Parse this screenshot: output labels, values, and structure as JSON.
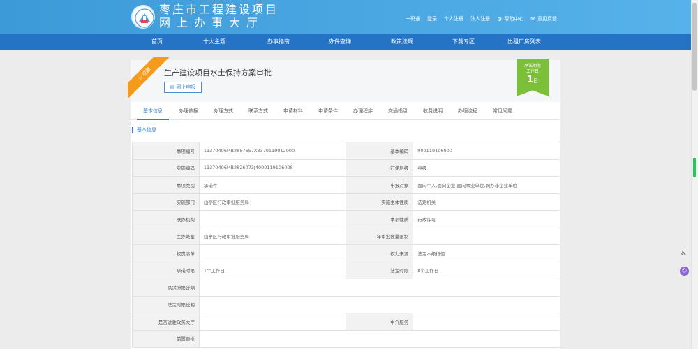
{
  "header": {
    "site_name_line1": "枣庄市工程建设项目",
    "site_name_line2": "网上办事大厅",
    "links": [
      {
        "label": "一码通",
        "icon": ""
      },
      {
        "label": "登录",
        "icon": ""
      },
      {
        "label": "个人注册",
        "icon": ""
      },
      {
        "label": "法人注册",
        "icon": ""
      },
      {
        "label": "帮助中心",
        "icon": "gear-icon"
      },
      {
        "label": "意见反馈",
        "icon": "message-icon"
      }
    ]
  },
  "nav": {
    "items": [
      {
        "label": "首页"
      },
      {
        "label": "十大主题"
      },
      {
        "label": "办事指南"
      },
      {
        "label": "办件查询"
      },
      {
        "label": "政策法规"
      },
      {
        "label": "下载专区"
      },
      {
        "label": "出租厂房列表"
      }
    ]
  },
  "item": {
    "ribbon_label": "☆ 收藏",
    "title": "生产建设项目水土保持方案审批",
    "apply_label": "网上申报",
    "badge_line1": "承诺期限",
    "badge_line2": "工作日",
    "badge_days": "1",
    "badge_unit": "日"
  },
  "tabs": [
    {
      "label": "基本信息",
      "active": true
    },
    {
      "label": "办理依据",
      "active": false
    },
    {
      "label": "办理方式",
      "active": false
    },
    {
      "label": "联系方式",
      "active": false
    },
    {
      "label": "申请材料",
      "active": false
    },
    {
      "label": "申请条件",
      "active": false
    },
    {
      "label": "办理程序",
      "active": false
    },
    {
      "label": "交通指引",
      "active": false
    },
    {
      "label": "收费说明",
      "active": false
    },
    {
      "label": "办理流程",
      "active": false
    },
    {
      "label": "常见问题",
      "active": false
    }
  ],
  "basic_info": {
    "section_title": "基本信息",
    "rows": [
      [
        "事项编号",
        "11370406MB2857657X3370119012000",
        "基本编码",
        "000119106000"
      ],
      [
        "实施编码",
        "11370406MB2826073J4000119106008",
        "行使层级",
        "县级"
      ],
      [
        "事项类别",
        "承诺件",
        "申报对象",
        "面向个人,面向企业,面向事业单位,网办非企业单位"
      ],
      [
        "实施部门",
        "山亭区行政审批服务局",
        "实施主体性质",
        "法定机关"
      ],
      [
        "联办机构",
        "",
        "事项性质",
        "行政许可"
      ],
      [
        "主办处室",
        "山亭区行政审批服务局",
        "年审批数量限制",
        ""
      ],
      [
        "权责清单",
        "",
        "权力来源",
        "法定本级行使"
      ],
      [
        "承诺时限",
        "1个工作日",
        "法定时限",
        "8个工作日"
      ],
      [
        "承诺时限说明",
        ""
      ],
      [
        "法定时限说明",
        ""
      ],
      [
        "是否进驻政务大厅",
        "",
        "中介服务",
        ""
      ],
      [
        "前置审批",
        ""
      ]
    ]
  },
  "colors": {
    "header": "#3c9ad8",
    "nav": "#2573c4",
    "accent": "#2b7ed3",
    "ribbon": "#f59b1c",
    "badge": "#7cbf38"
  }
}
